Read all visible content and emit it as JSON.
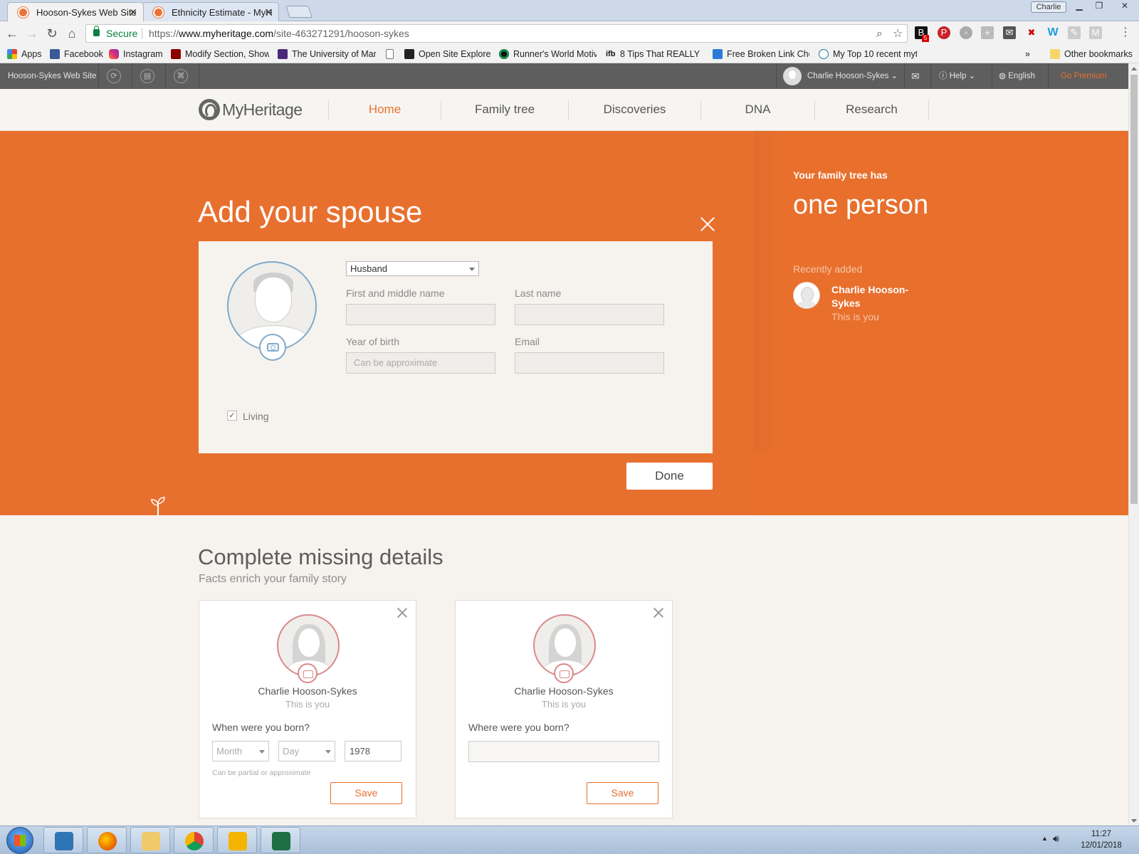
{
  "browser": {
    "tabs": [
      {
        "title": "Hooson-Sykes Web Site",
        "active": true
      },
      {
        "title": "Ethnicity Estimate - MyH",
        "active": false
      }
    ],
    "profile": "Charlie",
    "secure_label": "Secure",
    "url_scheme": "https://",
    "url_host": "www.myheritage.com",
    "url_path": "/site-463271291/hooson-sykes",
    "bookmarks": [
      {
        "label": "Apps",
        "icon": "apps-grid-icon"
      },
      {
        "label": "Facebook",
        "icon": "facebook-icon"
      },
      {
        "label": "Instagram",
        "icon": "instagram-icon"
      },
      {
        "label": "Modify Section, Show",
        "icon": "terminalfour-icon"
      },
      {
        "label": "The University of Man",
        "icon": "university-icon"
      },
      {
        "label": "",
        "icon": "page-icon"
      },
      {
        "label": "Open Site Explorer",
        "icon": "moz-icon"
      },
      {
        "label": "Runner's World Motiv",
        "icon": "runners-world-icon"
      },
      {
        "label": "8 Tips That REALLY Bu",
        "icon": "ifb-icon"
      },
      {
        "label": "Free Broken Link Chec",
        "icon": "checkmark-icon"
      },
      {
        "label": "My Top 10 recent myt",
        "icon": "wordpress-icon"
      }
    ],
    "other_bookmarks": "Other bookmarks",
    "extension_badge": "5"
  },
  "sitebar": {
    "site_name": "Hooson-Sykes Web Site",
    "user": "Charlie Hooson-Sykes",
    "help": "Help",
    "language": "English",
    "premium": "Go Premium"
  },
  "nav": {
    "logo": "MyHeritage",
    "items": [
      "Home",
      "Family tree",
      "Discoveries",
      "DNA",
      "Research"
    ],
    "active": "Home"
  },
  "add_spouse": {
    "title": "Add your spouse",
    "relation": "Husband",
    "first_name_label": "First and middle name",
    "last_name_label": "Last name",
    "year_label": "Year of birth",
    "year_placeholder": "Can be approximate",
    "email_label": "Email",
    "living_label": "Living",
    "living_checked": true,
    "done": "Done"
  },
  "tree_summary": {
    "heading": "Your family tree has",
    "count_text": "one person",
    "recent_label": "Recently added",
    "recent_name": "Charlie Hooson-Sykes",
    "recent_sub": "This is you"
  },
  "missing": {
    "title": "Complete missing details",
    "subtitle": "Facts enrich your family story",
    "cards": [
      {
        "name": "Charlie Hooson-Sykes",
        "sub": "This is you",
        "question": "When were you born?",
        "month_placeholder": "Month",
        "day_placeholder": "Day",
        "year": "1978",
        "hint": "Can be partial or approximate",
        "save": "Save"
      },
      {
        "name": "Charlie Hooson-Sykes",
        "sub": "This is you",
        "question": "Where were you born?",
        "save": "Save"
      }
    ]
  },
  "taskbar": {
    "time": "11:27",
    "date": "12/01/2018",
    "apps": [
      "lync-icon",
      "firefox-icon",
      "file-explorer-icon",
      "chrome-icon",
      "outlook-icon",
      "excel-icon"
    ]
  },
  "colors": {
    "brand_orange": "#e8702f",
    "site_bar": "#5e5e5e",
    "page_bg": "#f6f3ee"
  }
}
